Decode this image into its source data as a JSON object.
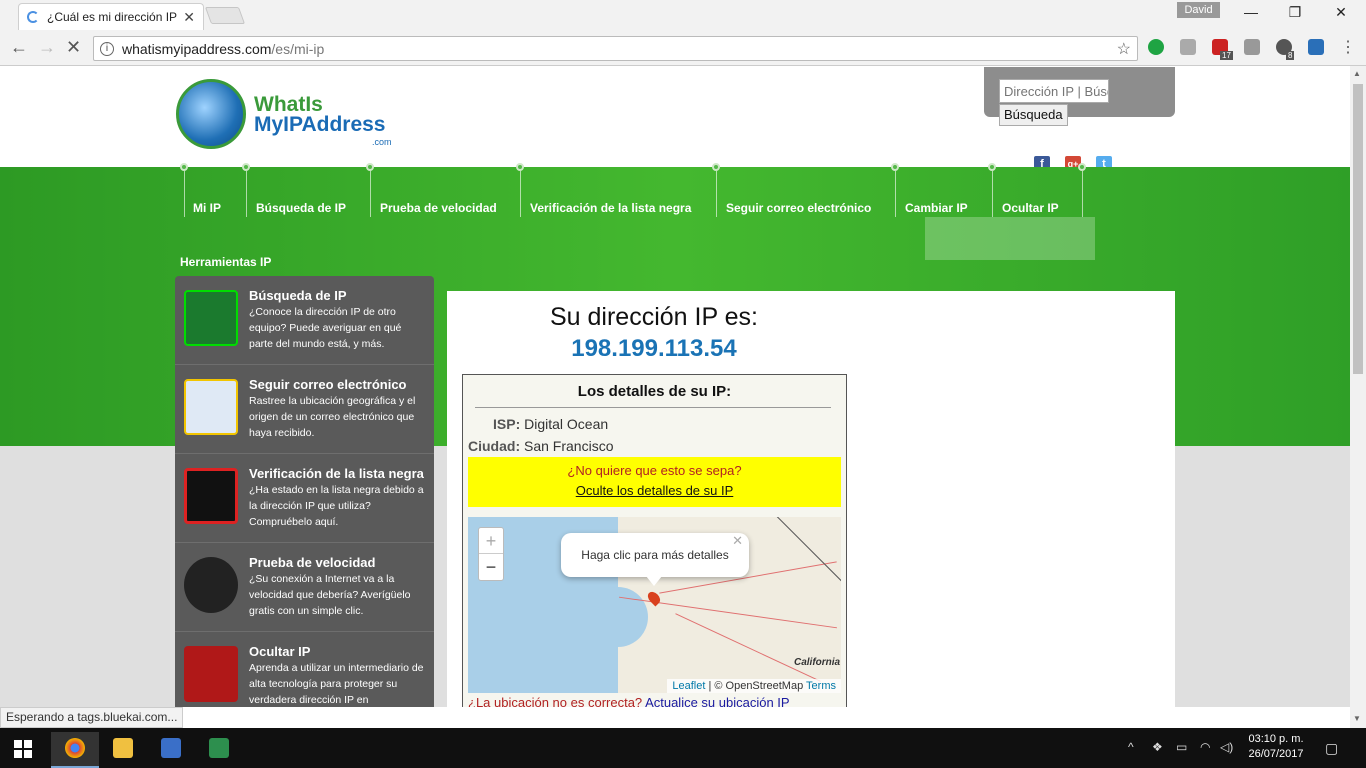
{
  "browser": {
    "tab_title": "¿Cuál es mi dirección IP?",
    "tab_close": "✕",
    "user": "David",
    "url_host": "whatismyipaddress.com",
    "url_path": "/es/mi-ip",
    "ext_badge_abp": "17",
    "ext_badge_other": "8"
  },
  "header": {
    "logo_line1": "WhatIs",
    "logo_line2": "MyIPAddress",
    "logo_line3": ".com",
    "search_placeholder": "Dirección IP | Búsqueda",
    "search_button": "Búsqueda"
  },
  "nav": {
    "items": [
      "Mi IP",
      "Búsqueda de IP",
      "Prueba de velocidad",
      "Verificación de la lista negra",
      "Seguir correo electrónico",
      "Cambiar IP",
      "Ocultar IP"
    ],
    "tools_label": "Herramientas IP"
  },
  "sidebar": {
    "items": [
      {
        "title": "Búsqueda de IP",
        "text": "¿Conoce la dirección IP de otro equipo? Puede averiguar en qué parte del mundo está, y más."
      },
      {
        "title": "Seguir correo electrónico",
        "text": "Rastree la ubicación geográfica y el origen de un correo electrónico que haya recibido."
      },
      {
        "title": "Verificación de la lista negra",
        "text": "¿Ha estado en la lista negra debido a la dirección IP que utiliza? Compruébelo aquí."
      },
      {
        "title": "Prueba de velocidad",
        "text": "¿Su conexión a Internet va a la velocidad que debería? Averígüelo gratis con un simple clic."
      },
      {
        "title": "Ocultar IP",
        "text": "Aprenda a utilizar un intermediario de alta tecnología para proteger su verdadera dirección IP en"
      }
    ]
  },
  "main": {
    "heading": "Su dirección IP es:",
    "ip": "198.199.113.54",
    "details_title": "Los detalles de su IP:",
    "isp_label": "ISP:",
    "isp_value": "Digital Ocean",
    "city_label": "Ciudad:",
    "city_value": "San Francisco",
    "hide_question": "¿No quiere que esto se sepa?",
    "hide_link": "Oculte los detalles de su IP",
    "map_popup": "Haga clic para más detalles",
    "map_region": "California",
    "map_zoom_in": "+",
    "map_zoom_out": "−",
    "attrib_leaflet": "Leaflet",
    "attrib_osm": "| © OpenStreetMap",
    "attrib_terms": "Terms",
    "wrong_question": "¿La ubicación no es correcta?",
    "wrong_link": "Actualice su ubicación IP"
  },
  "status_bar": "Esperando a tags.bluekai.com...",
  "taskbar": {
    "time": "03:10 p. m.",
    "date": "26/07/2017"
  },
  "colors": {
    "green": "#3aa82c",
    "ip_blue": "#1a73b5",
    "highlight": "#ffff00",
    "warning_red": "#b12222"
  }
}
